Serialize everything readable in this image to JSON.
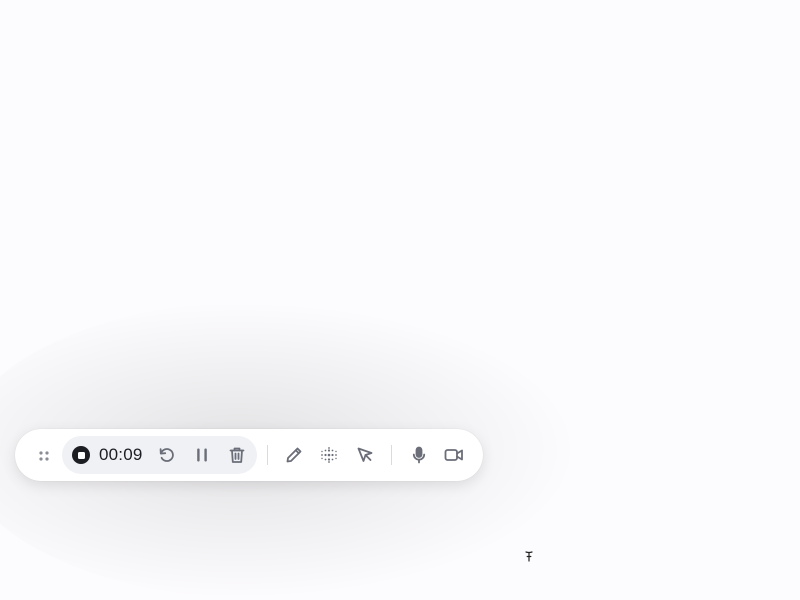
{
  "recording": {
    "timer": "00:09"
  },
  "icons": {
    "drag": "drag-handle-icon",
    "stop": "stop-icon",
    "restart": "restart-icon",
    "pause": "pause-icon",
    "delete": "trash-icon",
    "pen": "pen-icon",
    "blur": "blur-dots-icon",
    "pointer": "pointer-cursor-icon",
    "microphone": "microphone-icon",
    "camera": "video-camera-icon",
    "text_cursor": "text-cursor-icon"
  },
  "colors": {
    "background": "#fcfbfd",
    "toolbar": "#ffffff",
    "record_group": "#eff1f5",
    "icon": "#6b6e78",
    "text": "#1d1d24"
  }
}
